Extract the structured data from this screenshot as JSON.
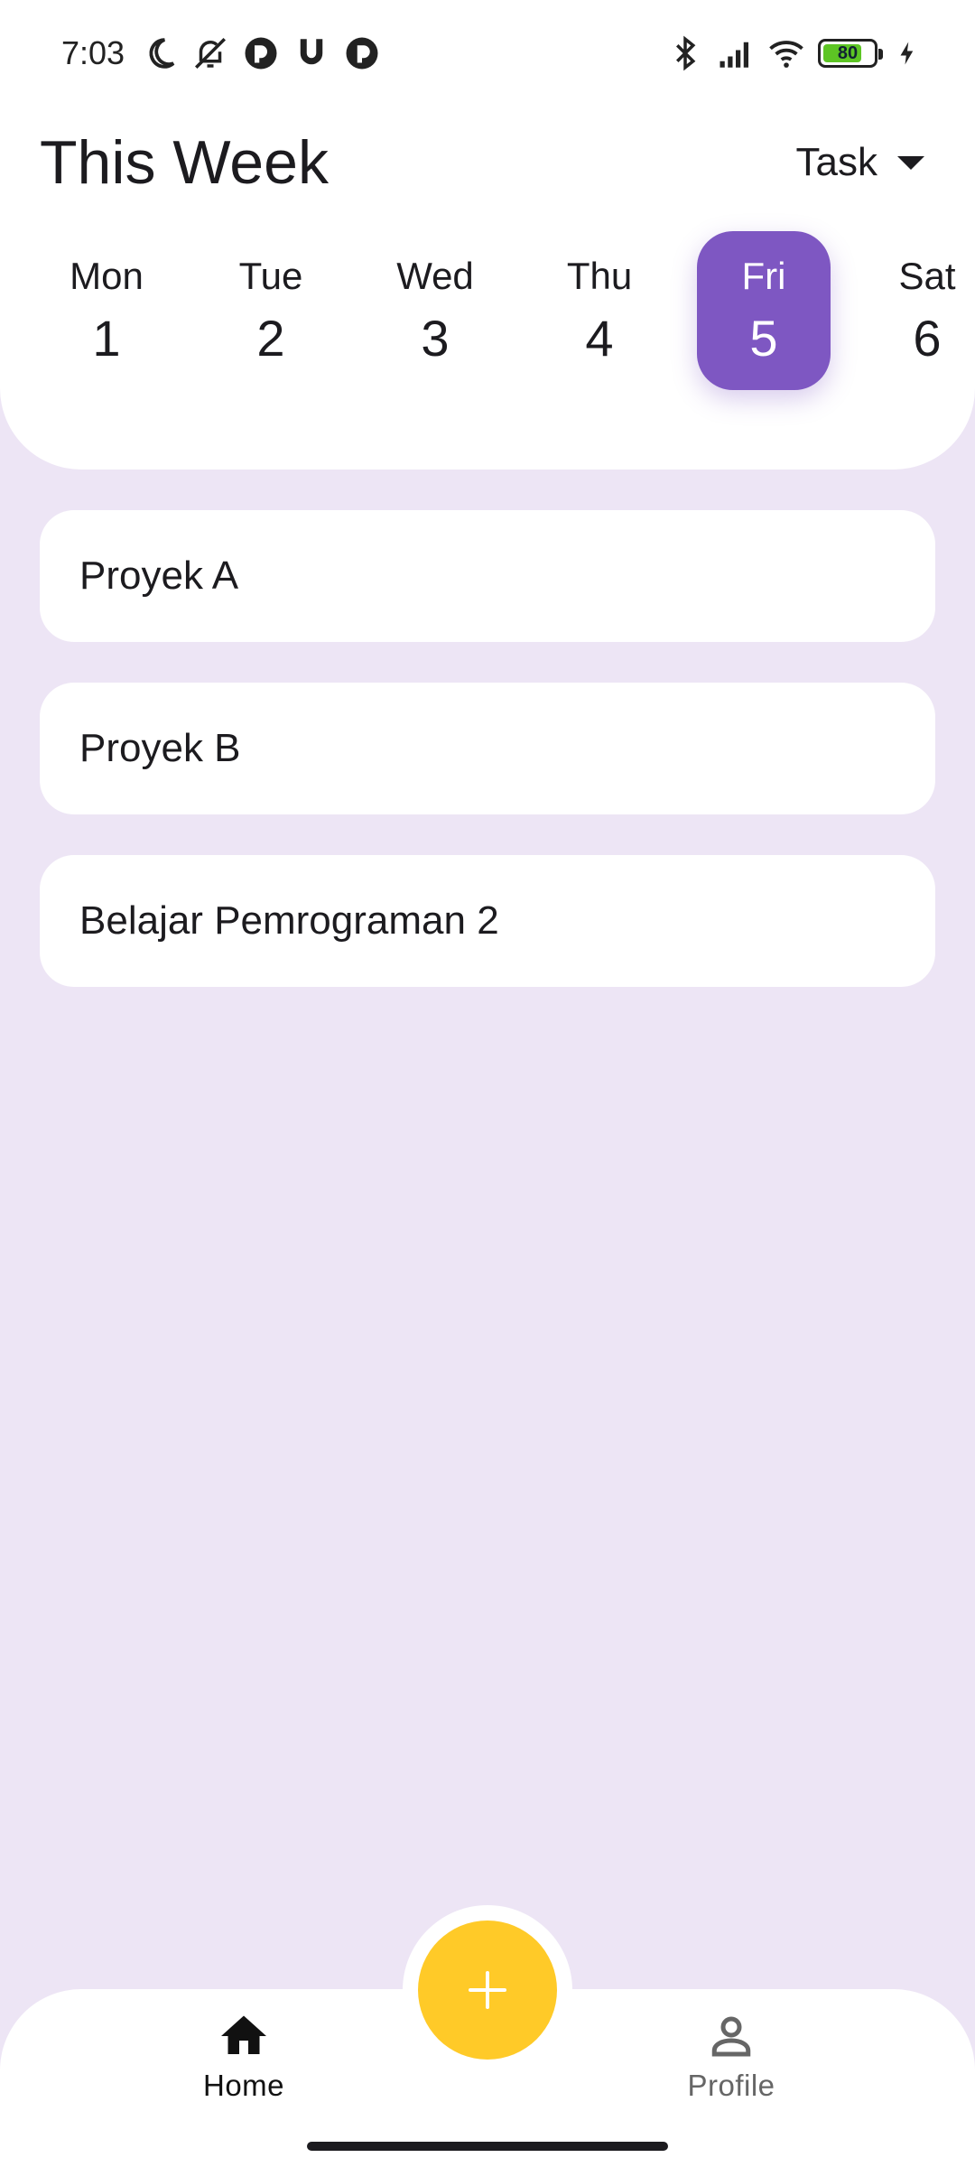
{
  "status_bar": {
    "time": "7:03",
    "left_icons": [
      "moon-icon",
      "notifications-off-icon",
      "app-icon",
      "magnet-icon",
      "app-icon"
    ],
    "right_icons": [
      "bluetooth-icon",
      "signal-icon",
      "wifi-icon",
      "battery-icon",
      "charging-icon"
    ],
    "battery_level": "80",
    "battery_fraction": 0.8,
    "battery_color": "#5DC524"
  },
  "header": {
    "title": "This Week",
    "filter_label": "Task"
  },
  "days": [
    {
      "name": "Mon",
      "date": "1",
      "selected": false
    },
    {
      "name": "Tue",
      "date": "2",
      "selected": false
    },
    {
      "name": "Wed",
      "date": "3",
      "selected": false
    },
    {
      "name": "Thu",
      "date": "4",
      "selected": false
    },
    {
      "name": "Fri",
      "date": "5",
      "selected": true
    },
    {
      "name": "Sat",
      "date": "6",
      "selected": false
    }
  ],
  "tasks": [
    {
      "title": "Proyek A"
    },
    {
      "title": "Proyek B"
    },
    {
      "title": "Belajar Pemrograman 2"
    }
  ],
  "fab": {
    "icon": "plus-icon",
    "color": "#FFCA28"
  },
  "bottom_nav": {
    "items": [
      {
        "label": "Home",
        "icon": "home-icon",
        "active": true
      },
      {
        "label": "Profile",
        "icon": "person-icon",
        "active": false
      }
    ]
  },
  "colors": {
    "accent": "#7E57C2",
    "background": "#EDE5F5",
    "fab": "#FFCA28",
    "surface": "#FFFFFF"
  }
}
